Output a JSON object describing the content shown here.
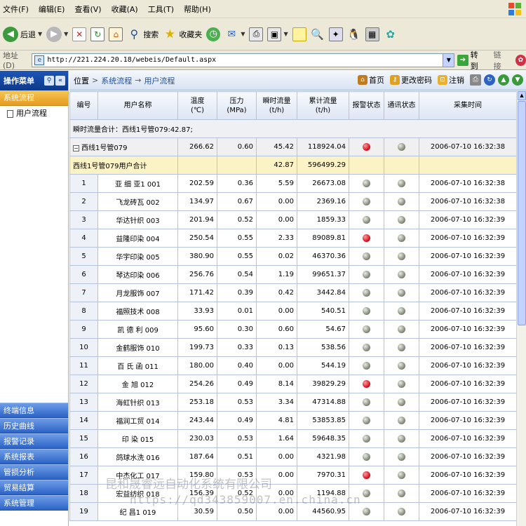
{
  "menubar": {
    "items": [
      "文件(F)",
      "编辑(E)",
      "查看(V)",
      "收藏(A)",
      "工具(T)",
      "帮助(H)"
    ]
  },
  "toolbar": {
    "back_label": "后退",
    "search_label": "搜索",
    "favorites_label": "收藏夹"
  },
  "address": {
    "label": "地址(D)",
    "url": "http://221.224.20.18/webeis/Default.aspx",
    "go_label": "转到",
    "links_label": "链接"
  },
  "sidebar": {
    "title": "操作菜单",
    "active": "系统流程",
    "sub_item": "用户流程",
    "menus": [
      "终端信息",
      "历史曲线",
      "报警记录",
      "系统报表",
      "管损分析",
      "贸易结算",
      "系统管理"
    ]
  },
  "breadcrumb": {
    "label": "位置",
    "level1": "系统流程",
    "arrow": "→",
    "level2": "用户流程",
    "tools": {
      "home": "首页",
      "password": "更改密码",
      "logout": "注销"
    }
  },
  "table": {
    "headers": {
      "no": "编号",
      "name": "用户名称",
      "temp": "温度",
      "temp_unit": "(℃)",
      "pressure": "压力",
      "pressure_unit": "(MPa)",
      "instant": "瞬时流量",
      "instant_unit": "(t/h)",
      "total": "累计流量",
      "total_unit": "(t/h)",
      "alarm": "报警状态",
      "comm": "通讯状态",
      "time": "采集时间"
    },
    "summary": "瞬时流量合计：西线1号管079:42.87;",
    "group": {
      "name": "西线1号管079",
      "temp": "266.62",
      "pressure": "0.60",
      "instant": "45.42",
      "total": "118924.04",
      "alarm": "red",
      "comm": "gray",
      "time": "2006-07-10 16:32:38"
    },
    "subtotal": {
      "label": "西线1号管079用户合计",
      "instant": "42.87",
      "total": "596499.29"
    },
    "rows": [
      {
        "no": "1",
        "name": "亚 细 亚1 001",
        "temp": "202.59",
        "pressure": "0.36",
        "instant": "5.59",
        "total": "26673.08",
        "alarm": "gray",
        "comm": "gray",
        "time": "2006-07-10 16:32:38"
      },
      {
        "no": "2",
        "name": "飞龙砖瓦 002",
        "temp": "134.97",
        "pressure": "0.67",
        "instant": "0.00",
        "total": "2369.16",
        "alarm": "gray",
        "comm": "gray",
        "time": "2006-07-10 16:32:38"
      },
      {
        "no": "3",
        "name": "华达针织 003",
        "temp": "201.94",
        "pressure": "0.52",
        "instant": "0.00",
        "total": "1859.33",
        "alarm": "gray",
        "comm": "gray",
        "time": "2006-07-10 16:32:39"
      },
      {
        "no": "4",
        "name": "益隆印染 004",
        "temp": "250.54",
        "pressure": "0.55",
        "instant": "2.33",
        "total": "89089.81",
        "alarm": "red",
        "comm": "gray",
        "time": "2006-07-10 16:32:39"
      },
      {
        "no": "5",
        "name": "华宇印染 005",
        "temp": "380.90",
        "pressure": "0.55",
        "instant": "0.02",
        "total": "46370.36",
        "alarm": "gray",
        "comm": "gray",
        "time": "2006-07-10 16:32:39"
      },
      {
        "no": "6",
        "name": "琴达印染 006",
        "temp": "256.76",
        "pressure": "0.54",
        "instant": "1.19",
        "total": "99651.37",
        "alarm": "gray",
        "comm": "gray",
        "time": "2006-07-10 16:32:39"
      },
      {
        "no": "7",
        "name": "月龙服饰 007",
        "temp": "171.42",
        "pressure": "0.39",
        "instant": "0.42",
        "total": "3442.84",
        "alarm": "gray",
        "comm": "gray",
        "time": "2006-07-10 16:32:39"
      },
      {
        "no": "8",
        "name": "福照技术 008",
        "temp": "33.93",
        "pressure": "0.01",
        "instant": "0.00",
        "total": "540.51",
        "alarm": "gray",
        "comm": "gray",
        "time": "2006-07-10 16:32:39"
      },
      {
        "no": "9",
        "name": "凯 德 利 009",
        "temp": "95.60",
        "pressure": "0.30",
        "instant": "0.60",
        "total": "54.67",
        "alarm": "gray",
        "comm": "gray",
        "time": "2006-07-10 16:32:39"
      },
      {
        "no": "10",
        "name": "金鹤服饰 010",
        "temp": "199.73",
        "pressure": "0.33",
        "instant": "0.13",
        "total": "538.56",
        "alarm": "gray",
        "comm": "gray",
        "time": "2006-07-10 16:32:39"
      },
      {
        "no": "11",
        "name": "百 氏 函 011",
        "temp": "180.00",
        "pressure": "0.40",
        "instant": "0.00",
        "total": "544.19",
        "alarm": "gray",
        "comm": "gray",
        "time": "2006-07-10 16:32:39"
      },
      {
        "no": "12",
        "name": "金 旭 012",
        "temp": "254.26",
        "pressure": "0.49",
        "instant": "8.14",
        "total": "39829.29",
        "alarm": "red",
        "comm": "gray",
        "time": "2006-07-10 16:32:39"
      },
      {
        "no": "13",
        "name": "海虹针织 013",
        "temp": "253.18",
        "pressure": "0.53",
        "instant": "3.34",
        "total": "47314.88",
        "alarm": "gray",
        "comm": "gray",
        "time": "2006-07-10 16:32:39"
      },
      {
        "no": "14",
        "name": "福润工贸 014",
        "temp": "243.44",
        "pressure": "0.49",
        "instant": "4.81",
        "total": "53853.85",
        "alarm": "gray",
        "comm": "gray",
        "time": "2006-07-10 16:32:39"
      },
      {
        "no": "15",
        "name": "印 染 015",
        "temp": "230.03",
        "pressure": "0.53",
        "instant": "1.64",
        "total": "59648.35",
        "alarm": "gray",
        "comm": "gray",
        "time": "2006-07-10 16:32:39"
      },
      {
        "no": "16",
        "name": "鸽球水洗 016",
        "temp": "187.64",
        "pressure": "0.51",
        "instant": "0.00",
        "total": "4321.98",
        "alarm": "gray",
        "comm": "gray",
        "time": "2006-07-10 16:32:39"
      },
      {
        "no": "17",
        "name": "中杰化工 017",
        "temp": "159.80",
        "pressure": "0.53",
        "instant": "0.00",
        "total": "7970.31",
        "alarm": "red",
        "comm": "gray",
        "time": "2006-07-10 16:32:39"
      },
      {
        "no": "18",
        "name": "宏益纺织 018",
        "temp": "156.39",
        "pressure": "0.52",
        "instant": "0.00",
        "total": "1194.88",
        "alarm": "gray",
        "comm": "gray",
        "time": "2006-07-10 16:32:39"
      },
      {
        "no": "19",
        "name": "纪 昌1 019",
        "temp": "30.59",
        "pressure": "0.50",
        "instant": "0.00",
        "total": "44560.95",
        "alarm": "gray",
        "comm": "gray",
        "time": "2006-07-10 16:32:39"
      }
    ]
  },
  "watermark": {
    "line1": "昆和晟睿远自动化系统有限公司",
    "line2": "https://qd343859007.en.china.cn"
  },
  "colors": {
    "sidebar_head": "#1c55b8",
    "active_item": "#e59b1f",
    "subtotal_row": "#fbf3c6",
    "alarm_red": "#d01020"
  }
}
